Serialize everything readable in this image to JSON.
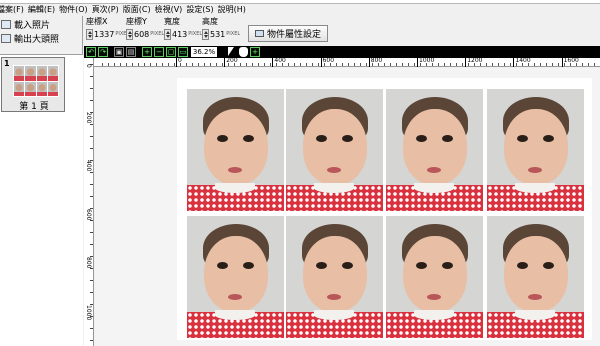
{
  "menu": [
    "檔案(F)",
    "編輯(E)",
    "物件(O)",
    "頁次(P)",
    "版面(C)",
    "檢視(V)",
    "設定(S)",
    "說明(H)"
  ],
  "left_panel": {
    "load_photo": "載入照片",
    "export_photo": "輸出大頭照",
    "page_number": "1",
    "page_label": "第 1 頁"
  },
  "props": {
    "x_label": "座標X",
    "x_value": "1337",
    "x_unit": "PIXEL",
    "y_label": "座標Y",
    "y_value": "608",
    "y_unit": "PIXEL",
    "w_label": "寬度",
    "w_value": "413",
    "w_unit": "PIXEL",
    "h_label": "高度",
    "h_value": "531",
    "h_unit": "PIXEL",
    "object_props_button": "物件屬性設定"
  },
  "viewbar": {
    "zoom": "36.2%"
  },
  "hruler_labels": [
    "0",
    "200",
    "400",
    "600",
    "800",
    "1000",
    "1200",
    "1400",
    "1600"
  ],
  "vruler_labels": [
    "0",
    "200",
    "400",
    "600",
    "800",
    "1000"
  ],
  "colors": {
    "viewbar_bg": "#000000",
    "viewbar_accent": "#5cd05c",
    "shirt": "#d9313e"
  }
}
